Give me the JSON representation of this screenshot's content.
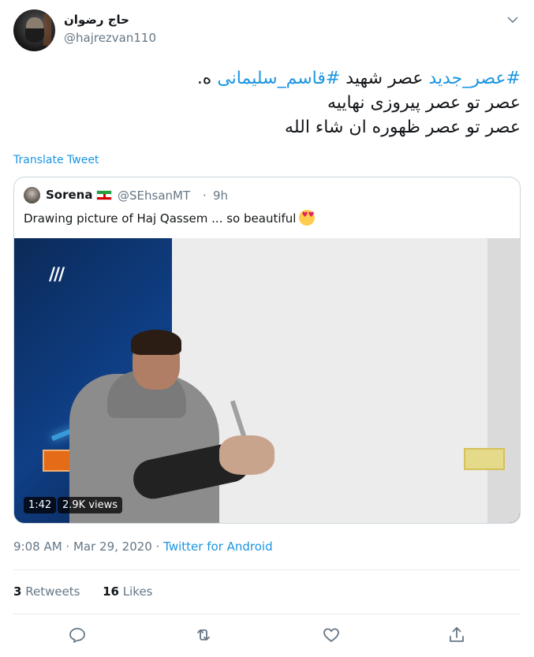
{
  "author": {
    "display_name": "حاج رضوان",
    "handle": "@hajrezvan110"
  },
  "tweet": {
    "line1_hashtag1": "#عصر_جدید",
    "line1_text": " عصر شهید ",
    "line1_hashtag2": "#قاسم_سلیمانی",
    "line1_end": " ه.",
    "line2": "عصر تو عصر پیروزی نهاییه",
    "line3": "عصر تو عصر ظهوره ان شاء الله",
    "translate_label": "Translate Tweet"
  },
  "quoted": {
    "name": "Sorena",
    "handle": "@SEhsanMT",
    "separator": "·",
    "time": "9h",
    "text": "Drawing picture of Haj Qassem ... so beautiful",
    "video_duration": "1:42",
    "video_views": "2.9K views"
  },
  "meta": {
    "time": "9:08 AM",
    "sep": " · ",
    "date": "Mar 29, 2020",
    "source": "Twitter for Android"
  },
  "stats": {
    "retweets_count": "3",
    "retweets_label": "Retweets",
    "likes_count": "16",
    "likes_label": "Likes"
  },
  "icons": {
    "chevron": "chevron-down-icon",
    "reply": "reply-icon",
    "retweet": "retweet-icon",
    "like": "heart-icon",
    "share": "share-icon"
  },
  "colors": {
    "accent": "#1b95e0",
    "muted": "#657786",
    "text": "#14171a",
    "border": "#e6ecf0"
  }
}
